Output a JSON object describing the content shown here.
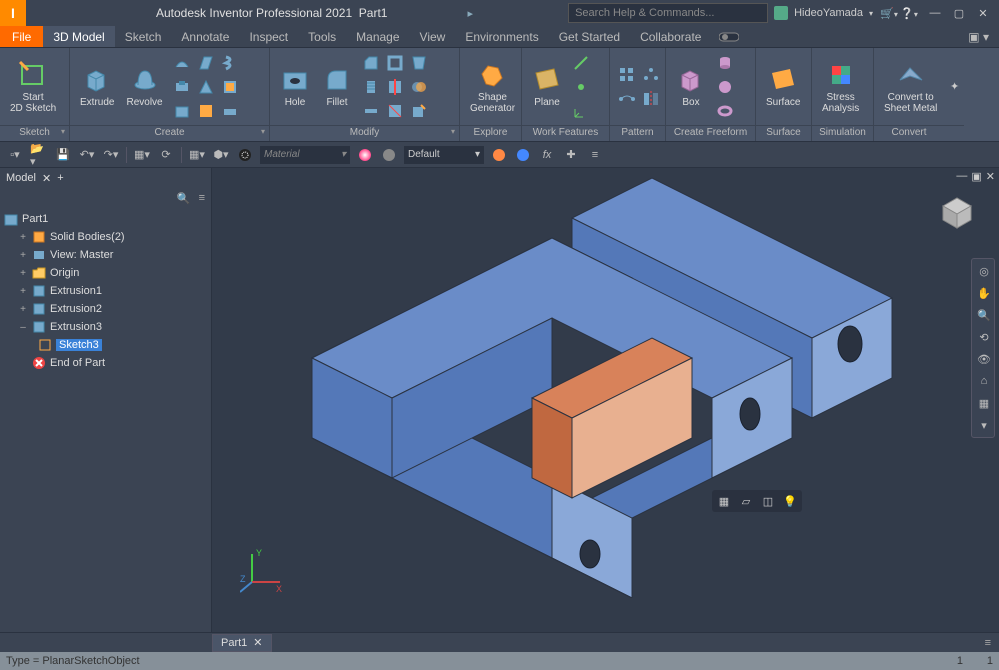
{
  "title": {
    "app": "Autodesk Inventor Professional 2021",
    "doc": "Part1"
  },
  "search": {
    "placeholder": "Search Help & Commands..."
  },
  "user": {
    "name": "HideoYamada"
  },
  "tabs": {
    "file": "File",
    "items": [
      "3D Model",
      "Sketch",
      "Annotate",
      "Inspect",
      "Tools",
      "Manage",
      "View",
      "Environments",
      "Get Started",
      "Collaborate"
    ],
    "active": 0
  },
  "ribbon": {
    "sketch": {
      "title": "Sketch",
      "start": "Start\n2D Sketch"
    },
    "create": {
      "title": "Create",
      "extrude": "Extrude",
      "revolve": "Revolve"
    },
    "modify": {
      "title": "Modify",
      "hole": "Hole",
      "fillet": "Fillet"
    },
    "explore": {
      "title": "Explore",
      "shape": "Shape\nGenerator"
    },
    "workfeat": {
      "title": "Work Features",
      "plane": "Plane"
    },
    "pattern": {
      "title": "Pattern"
    },
    "freeform": {
      "title": "Create Freeform",
      "box": "Box"
    },
    "surface": {
      "title": "Surface",
      "btn": "Surface"
    },
    "simulation": {
      "title": "Simulation",
      "stress": "Stress\nAnalysis"
    },
    "convert": {
      "title": "Convert",
      "sheet": "Convert to\nSheet Metal"
    }
  },
  "qat": {
    "material": "Material",
    "appearance": "Default",
    "fx": "fx"
  },
  "browser": {
    "title": "Model",
    "root": "Part1",
    "items": [
      {
        "label": "Solid Bodies(2)",
        "icon": "solid"
      },
      {
        "label": "View: Master",
        "icon": "view"
      },
      {
        "label": "Origin",
        "icon": "folder"
      },
      {
        "label": "Extrusion1",
        "icon": "extrude"
      },
      {
        "label": "Extrusion2",
        "icon": "extrude"
      },
      {
        "label": "Extrusion3",
        "icon": "extrude",
        "expanded": true
      },
      {
        "label": "Sketch3",
        "icon": "sketch",
        "indent": 2,
        "selected": true
      },
      {
        "label": "End of Part",
        "icon": "eop"
      }
    ]
  },
  "doctab": {
    "name": "Part1"
  },
  "status": {
    "type": "Type = PlanarSketchObject",
    "num1": "1",
    "num2": "1"
  }
}
